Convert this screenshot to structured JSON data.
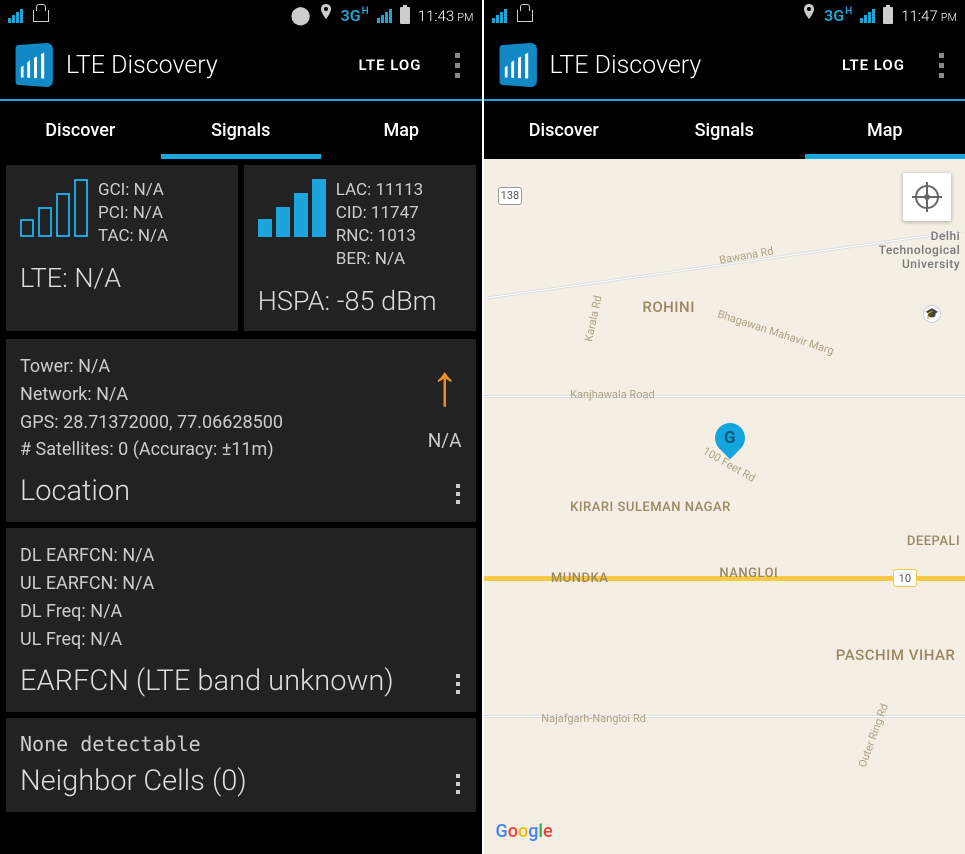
{
  "left": {
    "status": {
      "time": "11:43",
      "ampm": "PM",
      "net": "3G",
      "netSup": "H"
    },
    "app": {
      "title": "LTE Discovery",
      "btn": "LTE LOG"
    },
    "tabs": {
      "t0": "Discover",
      "t1": "Signals",
      "t2": "Map"
    },
    "lte": {
      "gci": "GCI: N/A",
      "pci": "PCI: N/A",
      "tac": "TAC: N/A",
      "main": "LTE: N/A"
    },
    "hspa": {
      "lac": "LAC: 11113",
      "cid": "CID: 11747",
      "rnc": "RNC: 1013",
      "ber": "BER: N/A",
      "main": "HSPA: -85 dBm"
    },
    "loc": {
      "tower": "Tower: N/A",
      "network": "Network: N/A",
      "gps": "GPS: 28.71372000, 77.06628500",
      "sats": "# Satellites: 0 (Accuracy: ±11m)",
      "title": "Location",
      "na": "N/A"
    },
    "earfcn": {
      "dle": "DL EARFCN: N/A",
      "ule": "UL EARFCN: N/A",
      "dlf": "DL Freq: N/A",
      "ulf": "UL Freq: N/A",
      "title": "EARFCN (LTE band unknown)"
    },
    "ncells": {
      "none": "None detectable",
      "title": "Neighbor Cells (0)"
    }
  },
  "right": {
    "status": {
      "time": "11:47",
      "ampm": "PM",
      "net": "3G",
      "netSup": "H"
    },
    "app": {
      "title": "LTE Discovery",
      "btn": "LTE LOG"
    },
    "tabs": {
      "t0": "Discover",
      "t1": "Signals",
      "t2": "Map"
    },
    "map": {
      "pin": "G",
      "areas": {
        "rohini": "ROHINI",
        "kirari": "KIRARI SULEMAN NAGAR",
        "nangloi": "NANGLOI",
        "mundka": "MUNDKA",
        "paschim": "PASCHIM VIHAR",
        "deepali": "DEEPALI",
        "dtu": "Delhi Technological University"
      },
      "roads": {
        "bawana": "Bawana Rd",
        "karala": "Karala Rd",
        "bhagawan": "Bhagawan Mahavir Marg",
        "kanjhawala": "Kanjhawala Road",
        "feet": "100 Feet Rd",
        "najafgarh": "Najafgarh-Nangloi Rd",
        "outer": "Outer Ring Rd"
      },
      "shields": {
        "s138": "138",
        "s10": "10"
      },
      "logo": "Google"
    }
  }
}
